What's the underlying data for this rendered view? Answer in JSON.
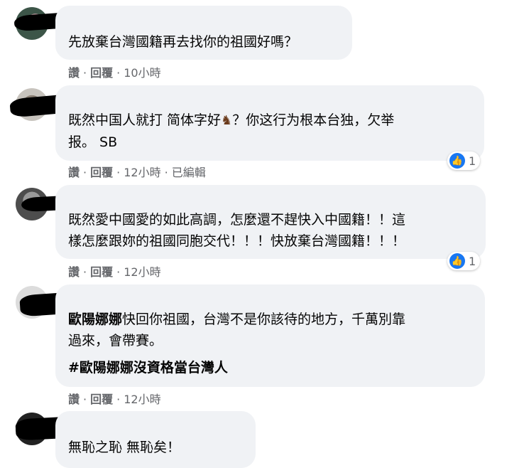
{
  "actions": {
    "like": "讚",
    "reply": "回覆",
    "edited": "已編輯"
  },
  "comments": [
    {
      "lines": [
        "先放棄台灣國籍再去找你的祖國好嗎？"
      ],
      "time": "10小時",
      "reactions": null
    },
    {
      "lines": [
        "既然中国人就打 简体字好",
        "？你这行为根本台独，欠举",
        "报。 SB"
      ],
      "emoji": "horse-emoji",
      "time": "12小時",
      "edited": true,
      "reactions": {
        "count": "1",
        "icon": "like-icon"
      }
    },
    {
      "lines": [
        "既然愛中國愛的如此高調，怎麼還不趕快入中國籍！！這",
        "樣怎麼跟妳的祖國同胞交代！！！快放棄台灣國籍！！！"
      ],
      "time": "12小時",
      "reactions": {
        "count": "1",
        "icon": "like-icon"
      }
    },
    {
      "mention": "歐陽娜娜",
      "lines": [
        "快回你祖國，台灣不是你該待的地方，千萬別靠",
        "過來，會帶賽。"
      ],
      "hashtag": "#歐陽娜娜沒資格當台灣人",
      "time": "12小時",
      "reactions": null
    },
    {
      "lines": [
        "無恥之恥 無恥矣！"
      ],
      "time": "",
      "reactions": null
    }
  ]
}
